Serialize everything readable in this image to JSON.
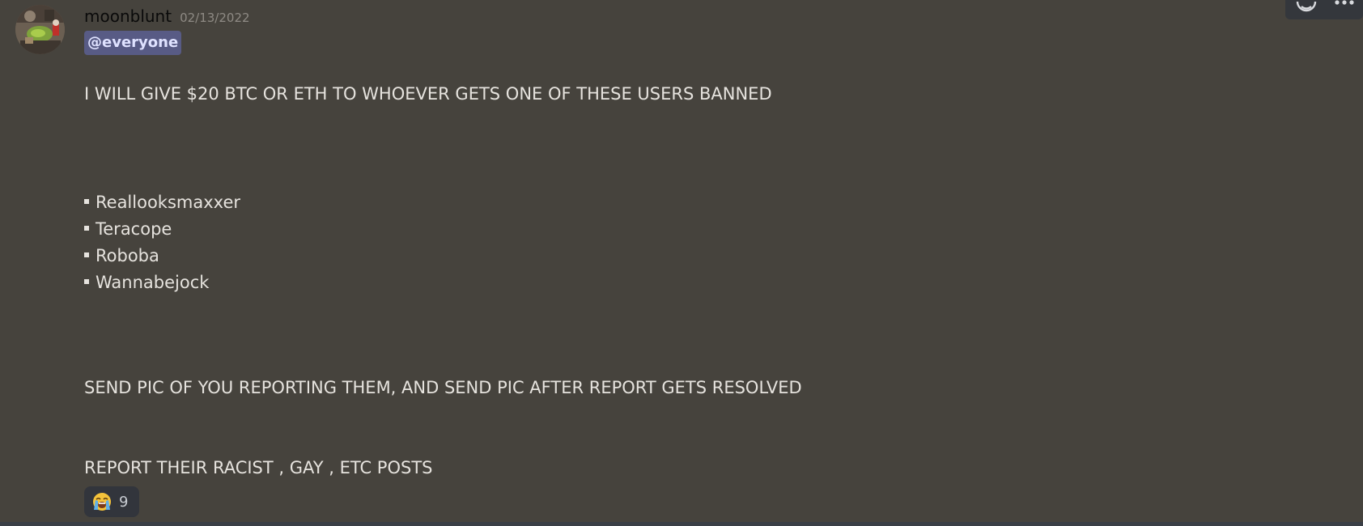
{
  "message": {
    "username": "moonblunt",
    "timestamp": "02/13/2022",
    "mention": "@everyone",
    "line1": "I WILL GIVE $20 BTC OR ETH TO WHOEVER GETS ONE OF THESE USERS BANNED",
    "users": [
      "Reallooksmaxxer",
      "Teracope",
      "Roboba",
      "Wannabejock"
    ],
    "line2": "SEND PIC OF YOU REPORTING THEM, AND SEND PIC AFTER REPORT GETS RESOLVED",
    "line3": "REPORT THEIR RACIST , GAY , ETC POSTS"
  },
  "reaction": {
    "emoji": "😭",
    "icon": "loudly-crying-face-icon",
    "count": "9"
  },
  "toolbar": {
    "icons": [
      "add-reaction-icon",
      "more-options-icon"
    ]
  },
  "colors": {
    "background": "#46433d",
    "mention_bg": "#585b85",
    "mention_text": "#dfe2ff",
    "reaction_bg": "#32353c"
  }
}
